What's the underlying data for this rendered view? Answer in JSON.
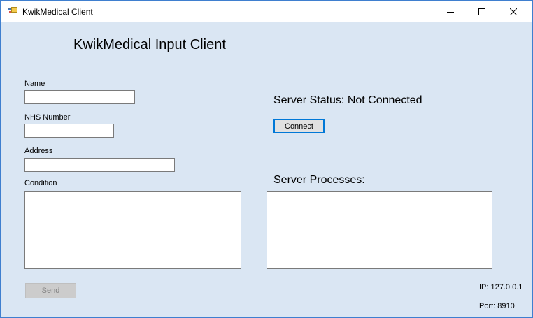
{
  "window": {
    "title": "KwikMedical Client"
  },
  "form": {
    "heading": "KwikMedical Input Client",
    "name_label": "Name",
    "name_value": "",
    "nhs_label": "NHS Number",
    "nhs_value": "",
    "address_label": "Address",
    "address_value": "",
    "condition_label": "Condition",
    "condition_value": "",
    "send_label": "Send"
  },
  "server": {
    "status_text": "Server Status: Not Connected",
    "connect_label": "Connect",
    "processes_label": "Server Processes:",
    "processes_value": "",
    "ip_text": "IP: 127.0.0.1",
    "port_text": "Port: 8910"
  },
  "icons": {
    "app": "app-window-icon",
    "minimize": "minimize-icon",
    "maximize": "maximize-icon",
    "close": "close-icon"
  },
  "colors": {
    "client_bg": "#dae6f3",
    "focus_border": "#0078d7"
  }
}
